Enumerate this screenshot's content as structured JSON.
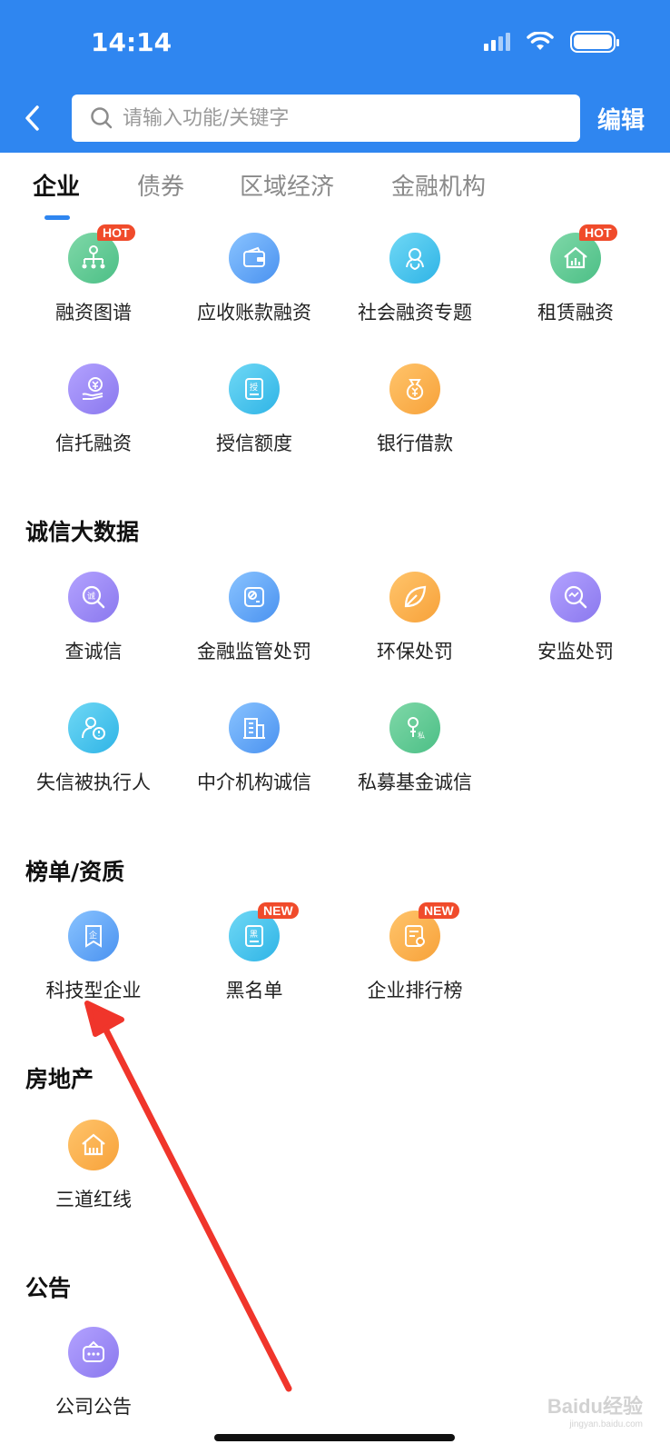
{
  "status": {
    "time": "14:14"
  },
  "search": {
    "placeholder": "请输入功能/关键字"
  },
  "header": {
    "edit_label": "编辑"
  },
  "tabs": [
    {
      "label": "企业",
      "active": true
    },
    {
      "label": "债券",
      "active": false
    },
    {
      "label": "区域经济",
      "active": false
    },
    {
      "label": "金融机构",
      "active": false
    }
  ],
  "financing": {
    "items": [
      {
        "label": "融资图谱",
        "badge": "HOT",
        "icon": "financing-map-icon",
        "color": "#5cc893"
      },
      {
        "label": "应收账款融资",
        "badge": "",
        "icon": "wallet-icon",
        "color": "#5a9ff2"
      },
      {
        "label": "社会融资专题",
        "badge": "",
        "icon": "people-circle-icon",
        "color": "#3dbdea"
      },
      {
        "label": "租赁融资",
        "badge": "HOT",
        "icon": "house-chart-icon",
        "color": "#5cc893"
      },
      {
        "label": "信托融资",
        "badge": "",
        "icon": "hand-yuan-icon",
        "color": "#9282f0"
      },
      {
        "label": "授信额度",
        "badge": "",
        "icon": "credit-doc-icon",
        "color": "#3dbdea"
      },
      {
        "label": "银行借款",
        "badge": "",
        "icon": "money-bag-icon",
        "color": "#f7a23a"
      }
    ]
  },
  "credit": {
    "title": "诚信大数据",
    "items": [
      {
        "label": "查诚信",
        "icon": "credit-search-icon"
      },
      {
        "label": "金融监管处罚",
        "icon": "regulation-icon"
      },
      {
        "label": "环保处罚",
        "icon": "leaf-icon"
      },
      {
        "label": "安监处罚",
        "icon": "safety-search-icon"
      },
      {
        "label": "失信被执行人",
        "icon": "person-alert-icon"
      },
      {
        "label": "中介机构诚信",
        "icon": "building-icon"
      },
      {
        "label": "私募基金诚信",
        "icon": "private-fund-icon"
      }
    ]
  },
  "ranking": {
    "title": "榜单/资质",
    "items": [
      {
        "label": "科技型企业",
        "badge": "",
        "icon": "enterprise-bookmark-icon"
      },
      {
        "label": "黑名单",
        "badge": "NEW",
        "icon": "blacklist-icon"
      },
      {
        "label": "企业排行榜",
        "badge": "NEW",
        "icon": "ranking-certificate-icon"
      }
    ]
  },
  "realestate": {
    "title": "房地产",
    "items": [
      {
        "label": "三道红线",
        "icon": "house-lines-icon"
      }
    ]
  },
  "announcement": {
    "title": "公告",
    "items": [
      {
        "label": "公司公告",
        "icon": "announcement-icon"
      }
    ]
  },
  "watermark": {
    "text": "Baidu经验",
    "sub": "jingyan.baidu.com"
  }
}
